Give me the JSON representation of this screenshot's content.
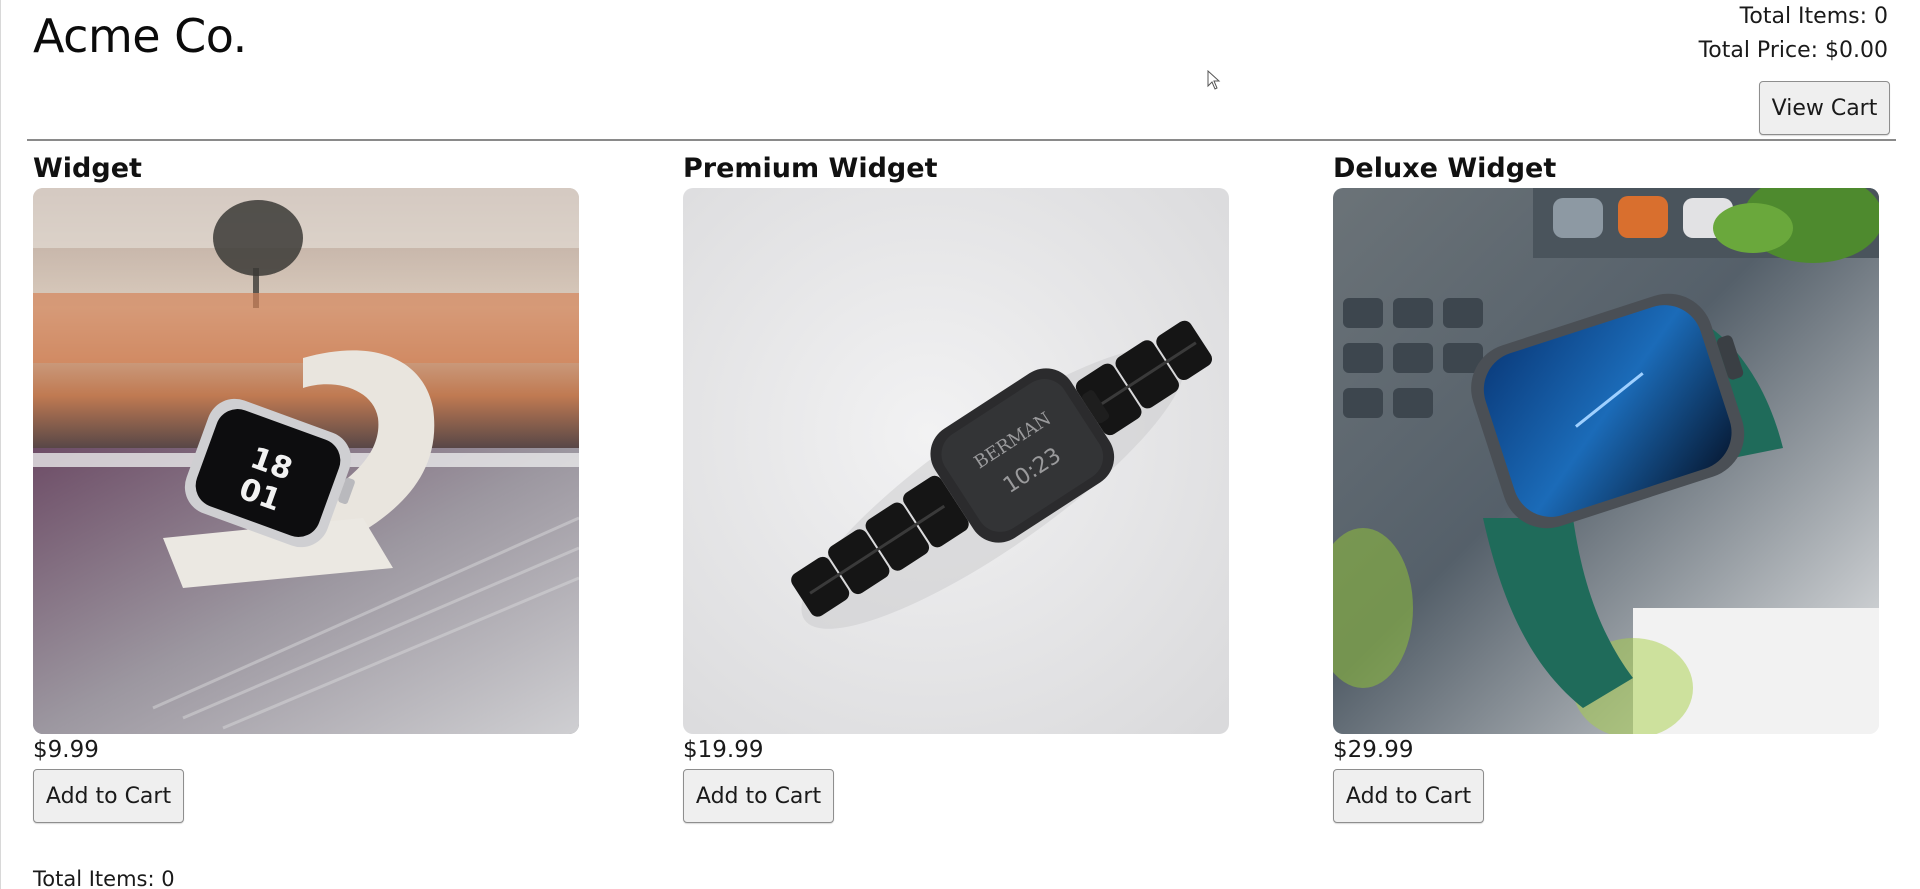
{
  "header": {
    "brand": "Acme Co.",
    "total_items_label": "Total Items: 0",
    "total_price_label": "Total Price: $0.00",
    "view_cart_label": "View Cart"
  },
  "products": [
    {
      "name": "Widget",
      "price": "$9.99",
      "button_label": "Add to Cart",
      "image_icon": "white-smartwatch-photo"
    },
    {
      "name": "Premium Widget",
      "price": "$19.99",
      "button_label": "Add to Cart",
      "image_icon": "black-link-bracelet-smartwatch-photo"
    },
    {
      "name": "Deluxe Widget",
      "price": "$29.99",
      "button_label": "Add to Cart",
      "image_icon": "green-band-smartwatch-photo"
    }
  ],
  "footer": {
    "total_items_label": "Total Items: 0"
  },
  "colors": {
    "background": "#ffffff",
    "divider": "#8a8a8a",
    "button_bg": "#efefef",
    "button_border": "#8e8e8e"
  }
}
